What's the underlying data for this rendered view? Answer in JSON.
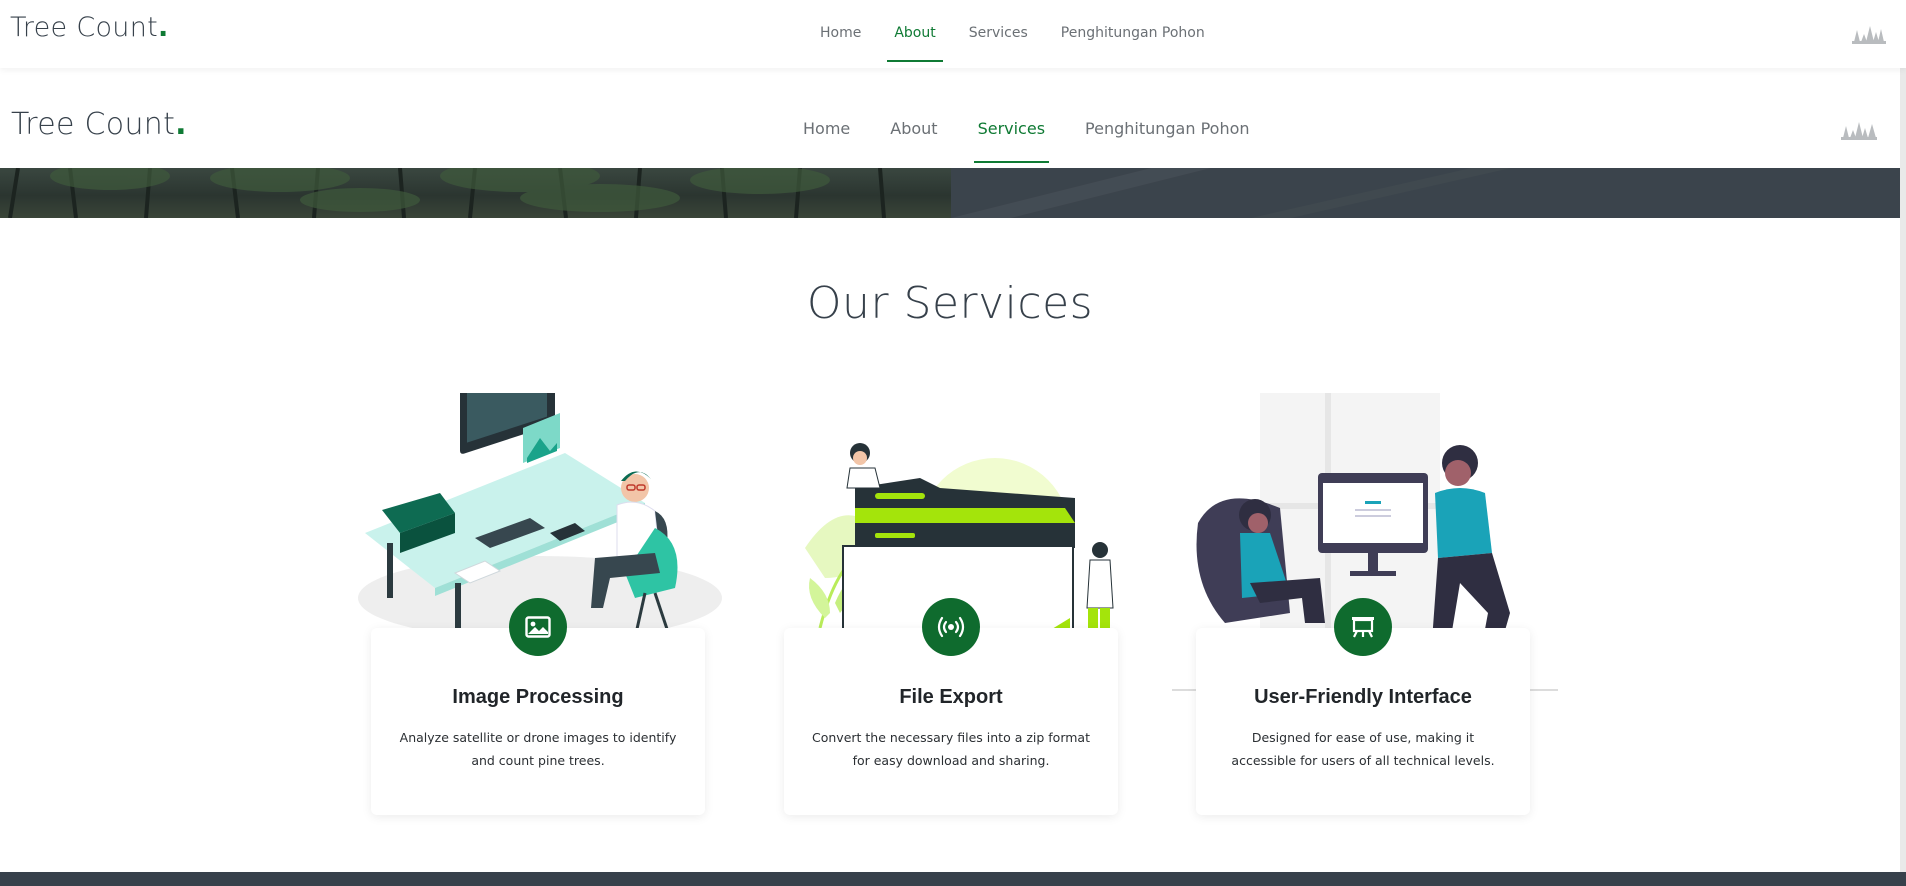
{
  "header_top": {
    "brand": "Tree Count",
    "brand_dot": ".",
    "nav": [
      "Home",
      "About",
      "Services",
      "Penghitungan Pohon"
    ],
    "active": "About"
  },
  "header_main": {
    "brand": "Tree Count",
    "brand_dot": ".",
    "nav": [
      "Home",
      "About",
      "Services",
      "Penghitungan Pohon"
    ],
    "active": "Services"
  },
  "services": {
    "title": "Our Services",
    "cards": [
      {
        "title": "Image Processing",
        "desc": "Analyze satellite or drone images to identify and count pine trees.",
        "icon": "image-icon"
      },
      {
        "title": "File Export",
        "desc": "Convert the necessary files into a zip format for easy download and sharing.",
        "icon": "broadcast-icon"
      },
      {
        "title": "User-Friendly Interface",
        "desc": "Designed for ease of use, making it accessible for users of all technical levels.",
        "icon": "presentation-icon"
      }
    ]
  },
  "colors": {
    "accent": "#0f7a34",
    "dark": "#37414b",
    "lime": "#a8e61d",
    "teal": "#1aa3b8"
  }
}
